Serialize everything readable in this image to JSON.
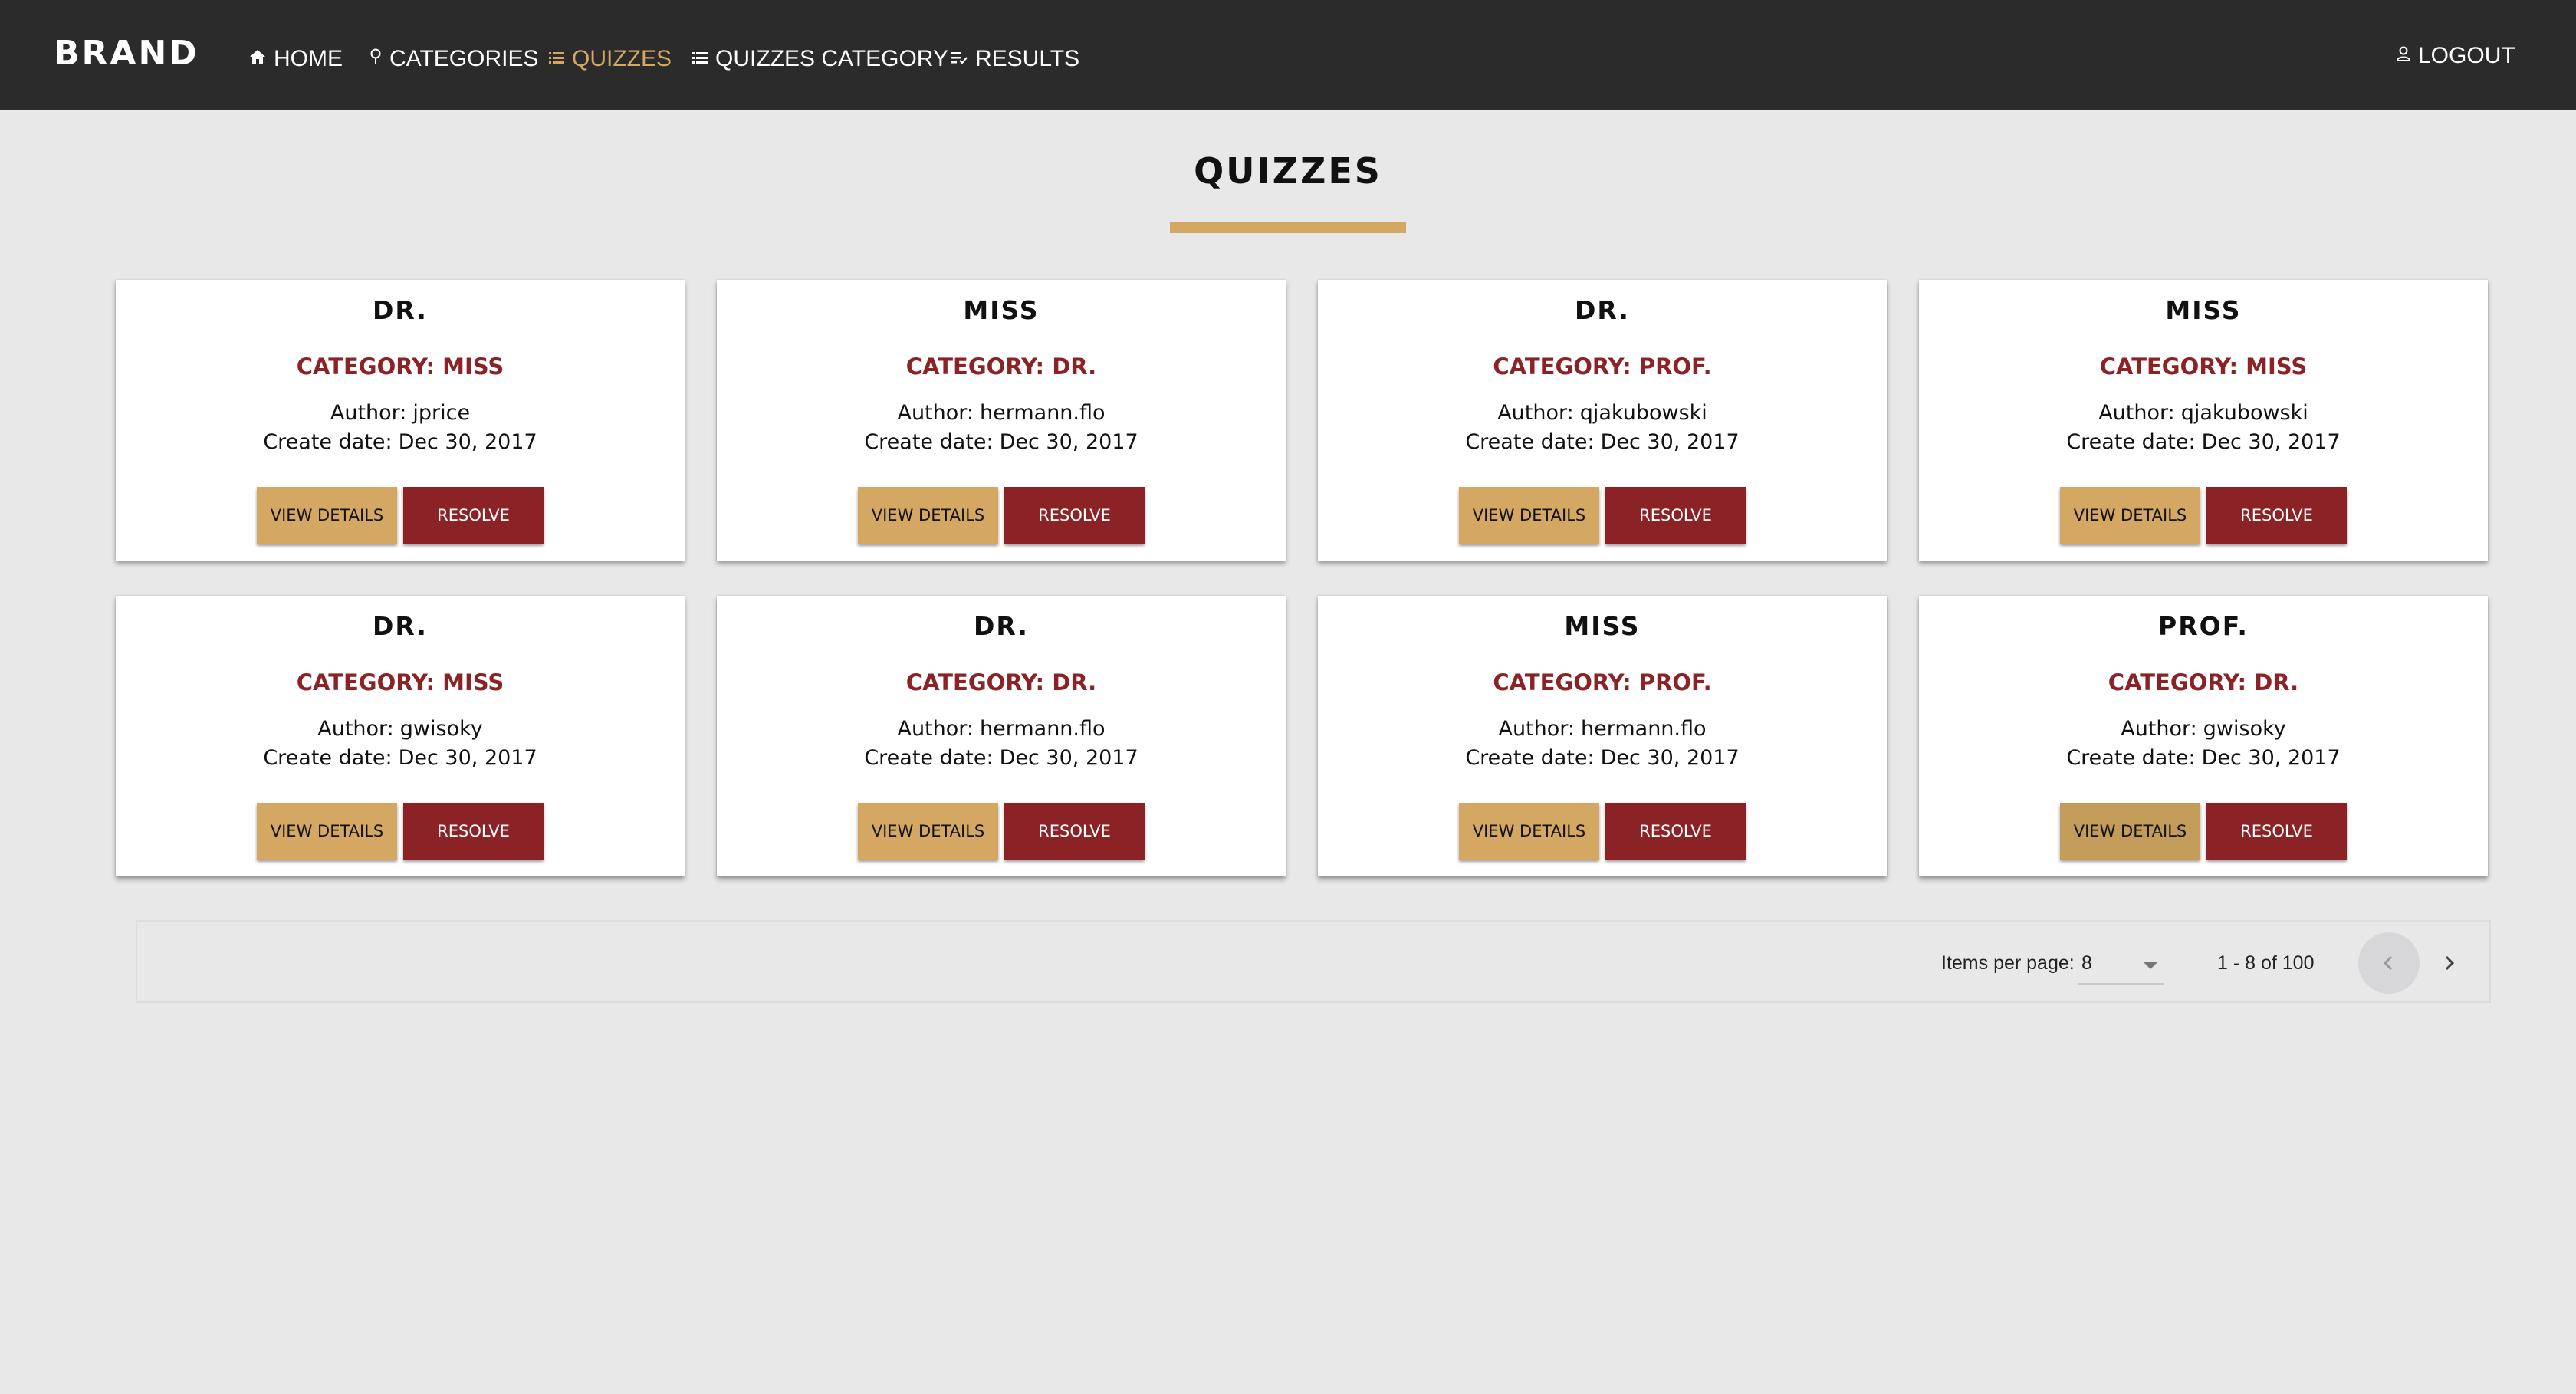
{
  "navbar": {
    "brand": "BRAND",
    "items": [
      {
        "label": "HOME",
        "icon": "home-icon"
      },
      {
        "label": "CATEGORIES",
        "icon": "pin-icon"
      },
      {
        "label": "QUIZZES",
        "icon": "list-icon",
        "active": true
      },
      {
        "label": "QUIZZES CATEGORY",
        "icon": "list-icon"
      },
      {
        "label": "RESULTS",
        "icon": "checklist-icon"
      }
    ],
    "logout": {
      "label": "LOGOUT",
      "icon": "user-icon"
    }
  },
  "page": {
    "title": "QUIZZES"
  },
  "labels": {
    "author": "Author:",
    "create_date": "Create date:",
    "view_details": "VIEW DETAILS",
    "resolve": "RESOLVE"
  },
  "cards": [
    {
      "title": "DR.",
      "category": "CATEGORY: MISS",
      "author": "jprice",
      "date": "Dec 30, 2017"
    },
    {
      "title": "MISS",
      "category": "CATEGORY: DR.",
      "author": "hermann.flo",
      "date": "Dec 30, 2017"
    },
    {
      "title": "DR.",
      "category": "CATEGORY: PROF.",
      "author": "qjakubowski",
      "date": "Dec 30, 2017"
    },
    {
      "title": "MISS",
      "category": "CATEGORY: MISS",
      "author": "qjakubowski",
      "date": "Dec 30, 2017"
    },
    {
      "title": "DR.",
      "category": "CATEGORY: MISS",
      "author": "gwisoky",
      "date": "Dec 30, 2017"
    },
    {
      "title": "DR.",
      "category": "CATEGORY: DR.",
      "author": "hermann.flo",
      "date": "Dec 30, 2017"
    },
    {
      "title": "MISS",
      "category": "CATEGORY: PROF.",
      "author": "hermann.flo",
      "date": "Dec 30, 2017"
    },
    {
      "title": "PROF.",
      "category": "CATEGORY: DR.",
      "author": "gwisoky",
      "date": "Dec 30, 2017"
    }
  ],
  "paginator": {
    "items_per_page_label": "Items per page:",
    "items_per_page_value": "8",
    "range_label": "1 - 8 of 100"
  },
  "colors": {
    "navbar": "#2b2b2b",
    "accent_gold": "#d4a862",
    "accent_red": "#8b2326",
    "background": "#e8e8e8"
  }
}
